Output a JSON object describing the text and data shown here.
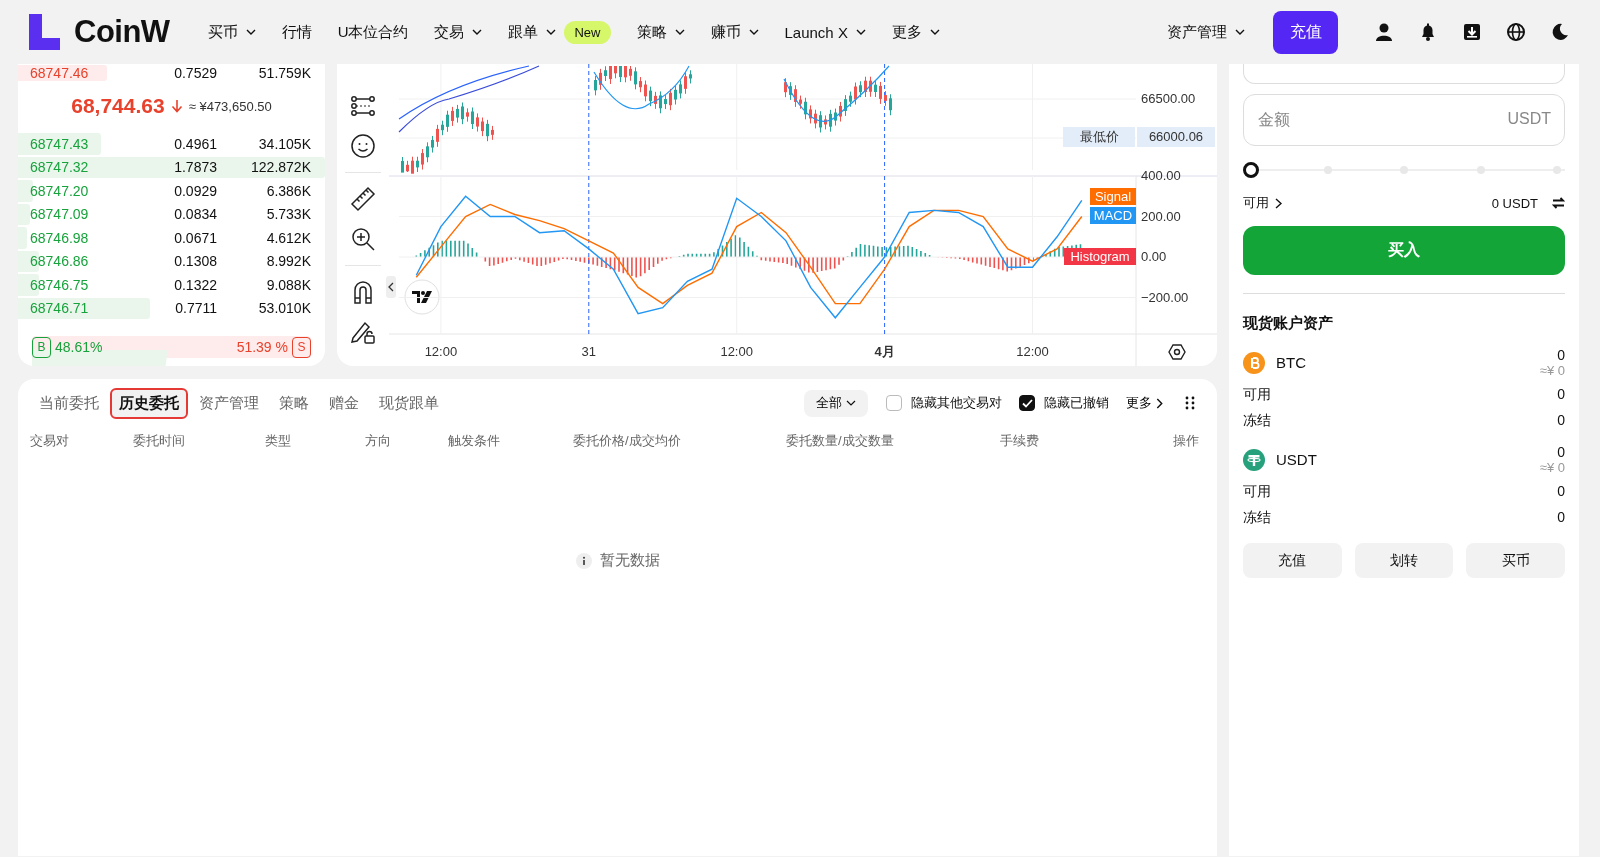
{
  "header": {
    "logo": "CoinW",
    "nav": [
      {
        "label": "买币",
        "dropdown": true
      },
      {
        "label": "行情",
        "dropdown": false
      },
      {
        "label": "U本位合约",
        "dropdown": false
      },
      {
        "label": "交易",
        "dropdown": true
      },
      {
        "label": "跟单",
        "dropdown": true,
        "badge": "New"
      },
      {
        "label": "策略",
        "dropdown": true
      },
      {
        "label": "赚币",
        "dropdown": true
      },
      {
        "label": "Launch X",
        "dropdown": true
      },
      {
        "label": "更多",
        "dropdown": true
      }
    ],
    "asset_menu": "资产管理",
    "deposit_button": "充值"
  },
  "order_book": {
    "asks": [
      {
        "price": "68747.46",
        "amount": "0.7529",
        "total": "51.759K",
        "level": 0.29
      }
    ],
    "last_price": "68,744.63",
    "falling": true,
    "fiat_price": "≈ ¥473,650.50",
    "bids": [
      {
        "price": "68747.43",
        "amount": "0.4961",
        "total": "34.105K",
        "level": 0.27
      },
      {
        "price": "68747.32",
        "amount": "1.7873",
        "total": "122.872K",
        "level": 1
      },
      {
        "price": "68747.20",
        "amount": "0.0929",
        "total": "6.386K",
        "level": 0.05
      },
      {
        "price": "68747.09",
        "amount": "0.0834",
        "total": "5.733K",
        "level": 0.04
      },
      {
        "price": "68746.98",
        "amount": "0.0671",
        "total": "4.612K",
        "level": 0.03
      },
      {
        "price": "68746.86",
        "amount": "0.1308",
        "total": "8.992K",
        "level": 0.07
      },
      {
        "price": "68746.75",
        "amount": "0.1322",
        "total": "9.088K",
        "level": 0.07
      },
      {
        "price": "68746.71",
        "amount": "0.7711",
        "total": "53.010K",
        "level": 0.43
      }
    ],
    "ratio": {
      "buy_label": "B",
      "buy": "48.61%",
      "sell": "51.39 %",
      "sell_label": "S",
      "level": 0.4861
    }
  },
  "chart": {
    "price_labels": [
      "66500.00"
    ],
    "low_price": {
      "label": "最低价",
      "value": "66000.06"
    },
    "histogram_label": "Histogram",
    "chart_data": {
      "type": "line",
      "categories": [
        null,
        "12:00",
        null,
        null,
        null,
        null,
        null,
        "31",
        null,
        null,
        null,
        null,
        null,
        "12:00",
        null,
        null,
        null,
        null,
        null,
        "4月",
        null,
        null,
        null,
        null,
        null,
        "12:00",
        null,
        null
      ],
      "series": [
        {
          "name": "Signal",
          "color": "#ff6d00",
          "values": [
            -100,
            50,
            200,
            260,
            210,
            180,
            140,
            80,
            20,
            -150,
            -230,
            -140,
            -80,
            150,
            220,
            120,
            -50,
            -230,
            -230,
            -60,
            150,
            230,
            230,
            200,
            40,
            -20,
            40,
            200
          ]
        },
        {
          "name": "MACD",
          "color": "#2196f3",
          "values": [
            -90,
            150,
            300,
            200,
            200,
            120,
            130,
            40,
            -60,
            -280,
            -250,
            -120,
            -60,
            290,
            200,
            80,
            -150,
            -300,
            -150,
            0,
            220,
            230,
            220,
            150,
            -50,
            -50,
            100,
            280
          ]
        }
      ],
      "ylim": [
        -380,
        400
      ],
      "grid": true,
      "yticks": [
        {
          "value": 400,
          "label": "400.00"
        },
        {
          "value": 200,
          "label": "200.00"
        },
        {
          "value": 0,
          "label": "0.00"
        },
        {
          "value": -200,
          "label": "−200.00"
        }
      ]
    }
  },
  "order_form": {
    "amount": {
      "placeholder": "金额",
      "unit": "USDT"
    },
    "slider": {
      "level": 0
    },
    "available_label": "可用",
    "available_value": "0 USDT",
    "buy_button": "买入"
  },
  "assets": {
    "title": "现货账户资产",
    "items": [
      {
        "coin": "BTC",
        "kind": "btc",
        "amount": "0",
        "fiat": "≈¥ 0",
        "available_label": "可用",
        "available": "0",
        "frozen_label": "冻结",
        "frozen": "0"
      },
      {
        "coin": "USDT",
        "kind": "usdt",
        "amount": "0",
        "fiat": "≈¥ 0",
        "available_label": "可用",
        "available": "0",
        "frozen_label": "冻结",
        "frozen": "0"
      }
    ],
    "buttons": [
      "充值",
      "划转",
      "买币"
    ]
  },
  "orders": {
    "tabs": [
      {
        "label": "当前委托",
        "selected": false
      },
      {
        "label": "历史委托",
        "selected": true
      },
      {
        "label": "资产管理",
        "selected": false
      },
      {
        "label": "策略",
        "selected": false
      },
      {
        "label": "赠金",
        "selected": false
      },
      {
        "label": "现货跟单",
        "selected": false
      }
    ],
    "filter": "全部",
    "toggles": [
      {
        "label": "隐藏其他交易对",
        "checked": false
      },
      {
        "label": "隐藏已撤销",
        "checked": true
      }
    ],
    "more": "更多",
    "columns": [
      "交易对",
      "委托时间",
      "类型",
      "方向",
      "触发条件",
      "委托价格/成交均价",
      "委托数量/成交数量",
      "手续费",
      "操作"
    ],
    "empty": "暂无数据"
  }
}
